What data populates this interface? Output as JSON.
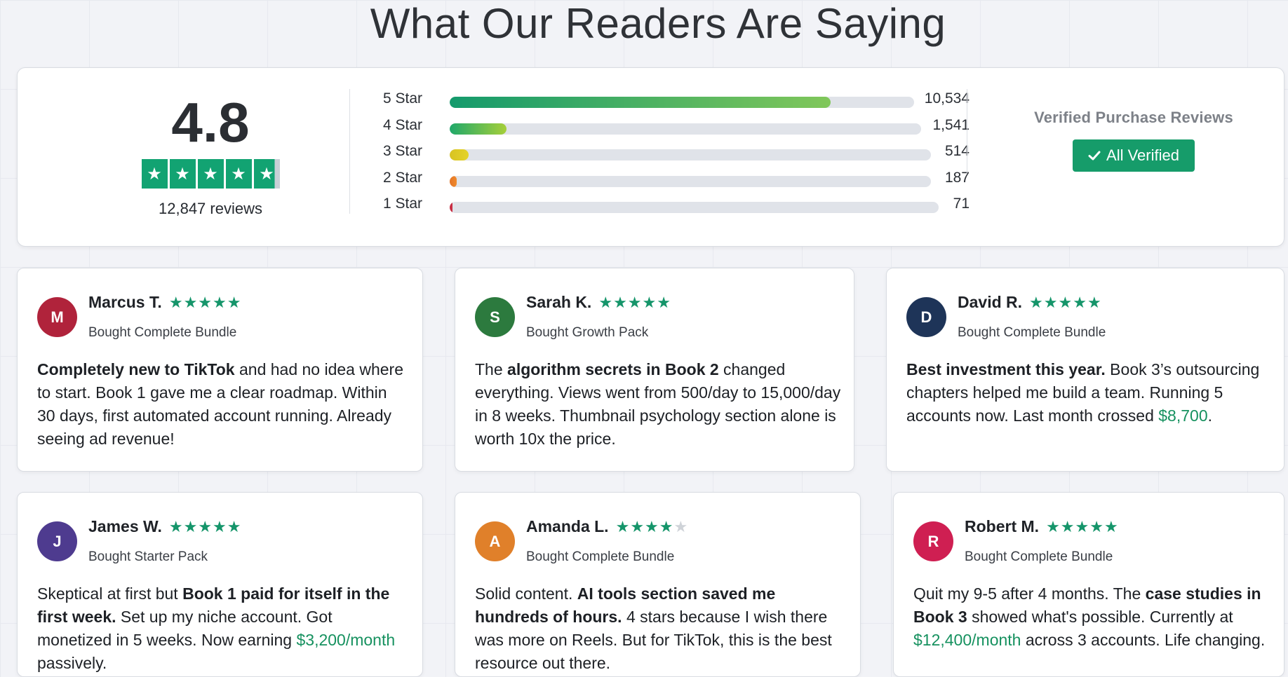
{
  "page_title": "What Our Readers Are Saying",
  "summary": {
    "score": "4.8",
    "review_count": "12,847 reviews",
    "stars_filled": 4.8,
    "breakdown": [
      {
        "label": "5 Star",
        "count": "10,534",
        "fraction": 0.82,
        "colors": [
          "#149a6c",
          "#80c75a"
        ]
      },
      {
        "label": "4 Star",
        "count": "1,541",
        "fraction": 0.12,
        "colors": [
          "#1fa86a",
          "#a6cf3a"
        ]
      },
      {
        "label": "3 Star",
        "count": "514",
        "fraction": 0.04,
        "colors": [
          "#d8c322",
          "#e4d32a"
        ]
      },
      {
        "label": "2 Star",
        "count": "187",
        "fraction": 0.015,
        "colors": [
          "#e47526",
          "#ef8a2c"
        ]
      },
      {
        "label": "1 Star",
        "count": "71",
        "fraction": 0.006,
        "colors": [
          "#c92f44",
          "#c92f44"
        ]
      }
    ],
    "verified_title": "Verified Purchase Reviews",
    "verified_button": "All Verified"
  },
  "reviews": [
    {
      "initial": "M",
      "avatar_color": "#b0233b",
      "name": "Marcus T.",
      "rating": 5,
      "purchase": "Bought Complete Bundle",
      "text": [
        {
          "t": "Completely new to TikTok",
          "s": "bold"
        },
        {
          "t": " and had no idea where to start. Book 1 gave me a clear roadmap. Within 30 days, first automated account running. Already seeing ad revenue!"
        }
      ]
    },
    {
      "initial": "S",
      "avatar_color": "#2c7a3e",
      "name": "Sarah K.",
      "rating": 5,
      "purchase": "Bought Growth Pack",
      "text": [
        {
          "t": "The "
        },
        {
          "t": "algorithm secrets in Book 2",
          "s": "bold"
        },
        {
          "t": " changed everything. Views went from 500/day to 15,000/day in 8 weeks. Thumbnail psychology section alone is worth 10x the price."
        }
      ]
    },
    {
      "initial": "D",
      "avatar_color": "#1e3458",
      "name": "David R.",
      "rating": 5,
      "purchase": "Bought Complete Bundle",
      "text": [
        {
          "t": "Best investment this year.",
          "s": "bold"
        },
        {
          "t": " Book 3’s outsourcing chapters helped me build a team. Running 5 accounts now. Last month crossed "
        },
        {
          "t": "$8,700",
          "s": "money"
        },
        {
          "t": "."
        }
      ]
    },
    {
      "initial": "J",
      "avatar_color": "#4e3b8f",
      "name": "James W.",
      "rating": 5,
      "purchase": "Bought Starter Pack",
      "text": [
        {
          "t": "Skeptical at first but "
        },
        {
          "t": "Book 1 paid for itself in the first week.",
          "s": "bold"
        },
        {
          "t": " Set up my niche account. Got monetized in 5 weeks. Now earning "
        },
        {
          "t": "$3,200/month",
          "s": "money"
        },
        {
          "t": " passively."
        }
      ]
    },
    {
      "initial": "A",
      "avatar_color": "#e0802a",
      "name": "Amanda L.",
      "rating": 4,
      "purchase": "Bought Complete Bundle",
      "text": [
        {
          "t": "Solid content. "
        },
        {
          "t": "AI tools section saved me hundreds of hours.",
          "s": "bold"
        },
        {
          "t": " 4 stars because I wish there was more on Reels. But for TikTok, this is the best resource out there."
        }
      ]
    },
    {
      "initial": "R",
      "avatar_color": "#cf1f52",
      "name": "Robert M.",
      "rating": 5,
      "purchase": "Bought Complete Bundle",
      "text": [
        {
          "t": "Quit my 9-5 after 4 months. The "
        },
        {
          "t": "case studies in Book 3",
          "s": "bold"
        },
        {
          "t": " showed what's possible. Currently at "
        },
        {
          "t": "$12,400/month",
          "s": "money"
        },
        {
          "t": " across 3 accounts. Life changing."
        }
      ]
    }
  ]
}
